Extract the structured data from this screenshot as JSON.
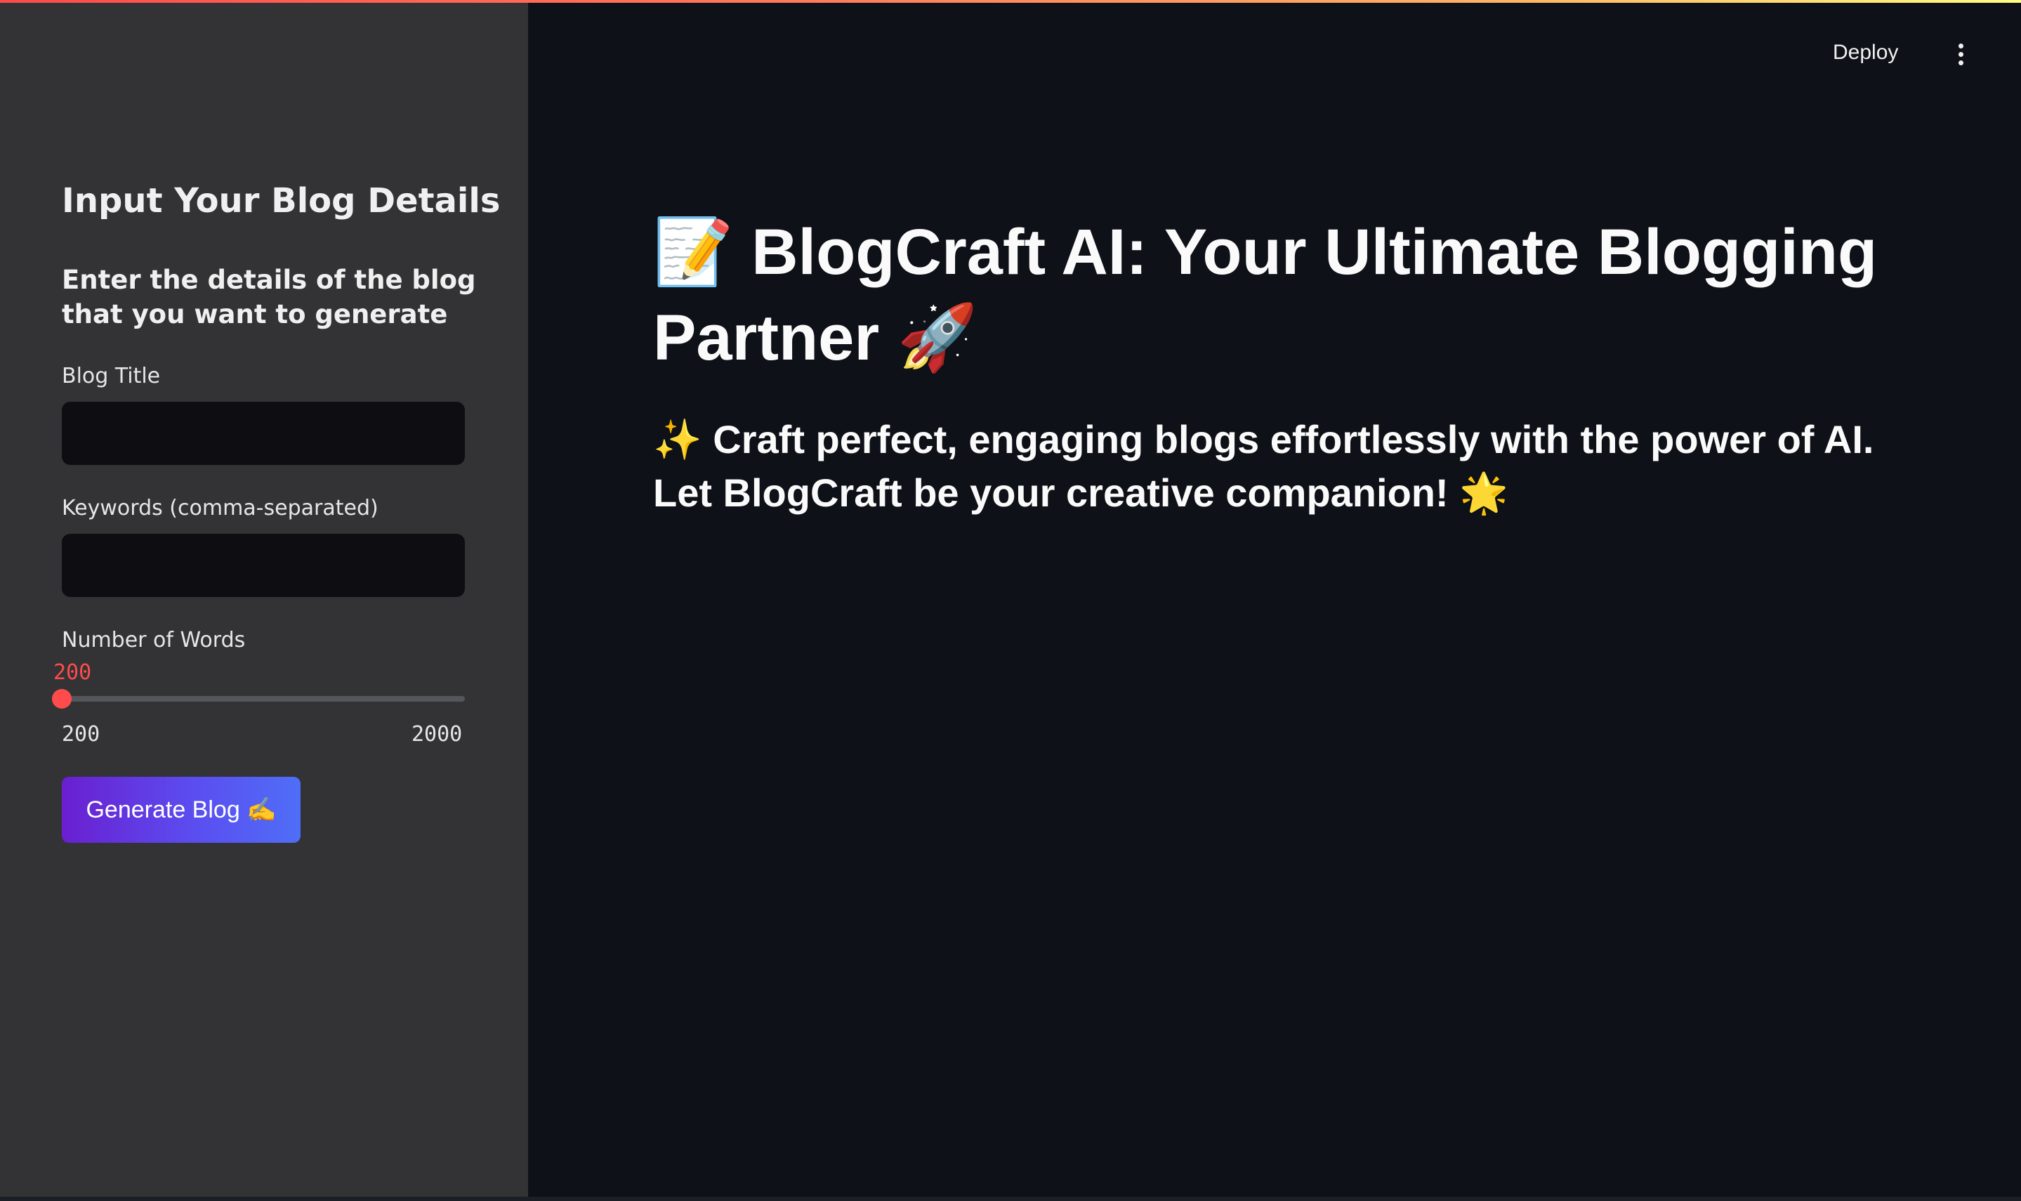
{
  "sidebar": {
    "heading": "Input Your Blog Details",
    "subheading": "Enter the details of the blog that you want to generate",
    "blog_title": {
      "label": "Blog Title",
      "value": "",
      "placeholder": ""
    },
    "keywords": {
      "label": "Keywords (comma-separated)",
      "value": "",
      "placeholder": ""
    },
    "word_count": {
      "label": "Number of Words",
      "value": "200",
      "min": "200",
      "max": "2000",
      "fraction": 0
    },
    "generate_button": {
      "label": "Generate Blog ✍️"
    }
  },
  "header": {
    "deploy_label": "Deploy",
    "menu_icon": "vertical-dots-icon"
  },
  "main": {
    "title": "📝 BlogCraft AI: Your Ultimate Blogging Partner 🚀",
    "subtitle": "✨ Craft perfect, engaging blogs effortlessly with the power of AI. Let BlogCraft be your creative companion! 🌟"
  },
  "colors": {
    "background": "#0e1117",
    "sidebar": "#333336",
    "accent": "#ff4b4b",
    "button_gradient_start": "#6a1fd0",
    "button_gradient_end": "#4f6ef7"
  }
}
